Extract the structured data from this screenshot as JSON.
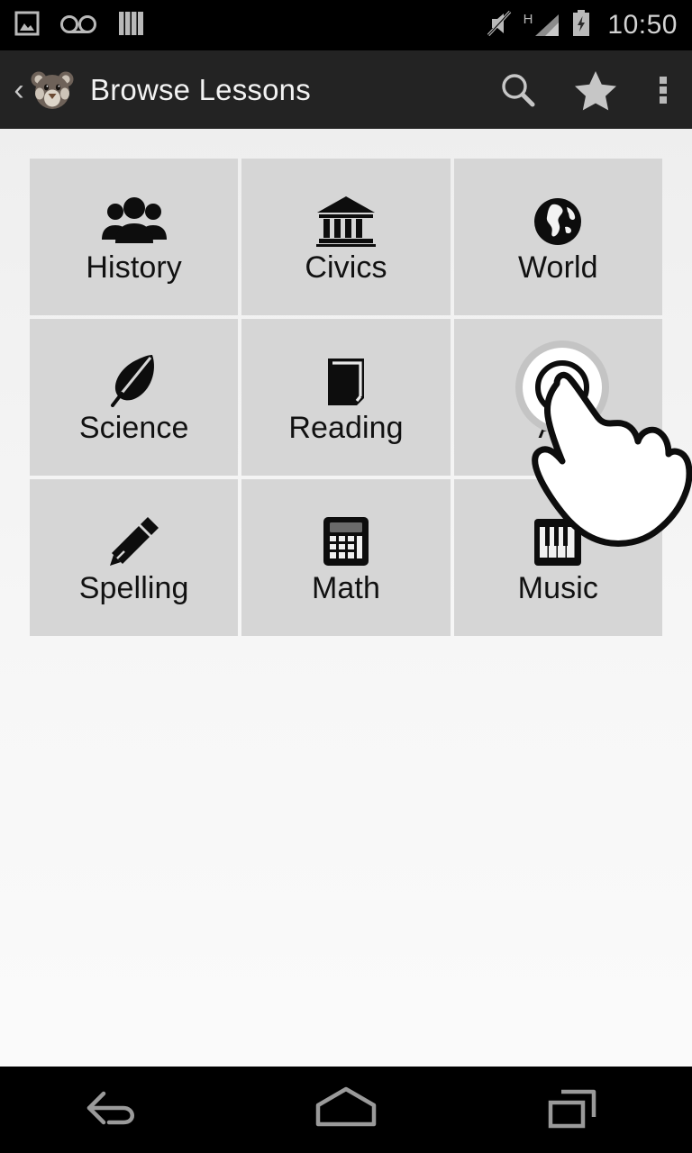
{
  "status_bar": {
    "time": "10:50",
    "left_icons": [
      {
        "name": "image-icon",
        "label": "Screenshot"
      },
      {
        "name": "voicemail-icon",
        "label": "Voicemail"
      },
      {
        "name": "library-bars-icon",
        "label": "Library"
      }
    ],
    "right_icons": [
      {
        "name": "mute-icon",
        "label": "Silent"
      },
      {
        "name": "signal-h-icon",
        "label": "H"
      },
      {
        "name": "battery-charging-icon",
        "label": "Charging"
      }
    ],
    "signal_label": "H"
  },
  "action_bar": {
    "back_label": "‹",
    "logo_name": "bear-logo",
    "title": "Browse Lessons",
    "actions": [
      {
        "name": "search-button",
        "label": "Search"
      },
      {
        "name": "favorites-button",
        "label": "Favorites"
      },
      {
        "name": "overflow-menu-button",
        "label": "More options"
      }
    ]
  },
  "grid": {
    "tiles": [
      {
        "label": "History",
        "icon": "people-group-icon"
      },
      {
        "label": "Civics",
        "icon": "bank-building-icon"
      },
      {
        "label": "World",
        "icon": "globe-icon"
      },
      {
        "label": "Science",
        "icon": "leaf-icon"
      },
      {
        "label": "Reading",
        "icon": "book-icon"
      },
      {
        "label": "Art",
        "icon": "art-icon"
      },
      {
        "label": "Spelling",
        "icon": "pencil-icon"
      },
      {
        "label": "Math",
        "icon": "calculator-icon"
      },
      {
        "label": "Music",
        "icon": "piano-keys-icon"
      }
    ]
  },
  "touch_gesture": {
    "name": "tap-gesture-indicator",
    "target_tile": "Art"
  },
  "nav_bar": {
    "buttons": [
      {
        "name": "nav-back-button",
        "label": "Back"
      },
      {
        "name": "nav-home-button",
        "label": "Home"
      },
      {
        "name": "nav-recents-button",
        "label": "Recent apps"
      }
    ]
  },
  "colors": {
    "status_bar_bg": "#000000",
    "action_bar_bg": "#232323",
    "tile_bg": "#d6d6d6",
    "page_bg": "#f0f0f0",
    "icon_fg": "#0d0d0d",
    "bar_icon_fg": "#b9b9b9",
    "logo_body": "#6e6259"
  }
}
